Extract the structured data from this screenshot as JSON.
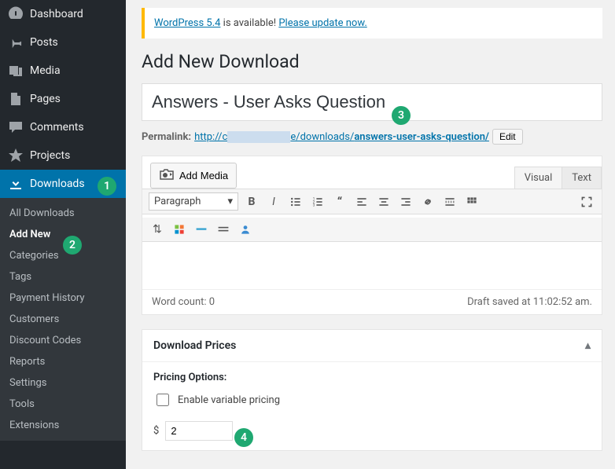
{
  "sidebar": {
    "items": [
      {
        "label": "Dashboard"
      },
      {
        "label": "Posts"
      },
      {
        "label": "Media"
      },
      {
        "label": "Pages"
      },
      {
        "label": "Comments"
      },
      {
        "label": "Projects"
      },
      {
        "label": "Downloads"
      }
    ],
    "submenu": [
      {
        "label": "All Downloads"
      },
      {
        "label": "Add New"
      },
      {
        "label": "Categories"
      },
      {
        "label": "Tags"
      },
      {
        "label": "Payment History"
      },
      {
        "label": "Customers"
      },
      {
        "label": "Discount Codes"
      },
      {
        "label": "Reports"
      },
      {
        "label": "Settings"
      },
      {
        "label": "Tools"
      },
      {
        "label": "Extensions"
      }
    ]
  },
  "notice": {
    "prefix": "WordPress 5.4",
    "middle": " is available! ",
    "link": "Please update now."
  },
  "page": {
    "heading": "Add New Download",
    "title_value": "Answers - User Asks Question",
    "permalink_label": "Permalink:",
    "permalink_base": "http://c",
    "permalink_mid": "e/downloads/",
    "permalink_slug": "answers-user-asks-question/",
    "edit": "Edit"
  },
  "editor": {
    "add_media": "Add Media",
    "tab_visual": "Visual",
    "tab_text": "Text",
    "format": "Paragraph",
    "word_count": "Word count: 0",
    "draft": "Draft saved at 11:02:52 am."
  },
  "prices": {
    "title": "Download Prices",
    "options_label": "Pricing Options:",
    "variable_label": "Enable variable pricing",
    "currency": "$",
    "value": "2"
  },
  "badges": {
    "b1": "1",
    "b2": "2",
    "b3": "3",
    "b4": "4"
  }
}
